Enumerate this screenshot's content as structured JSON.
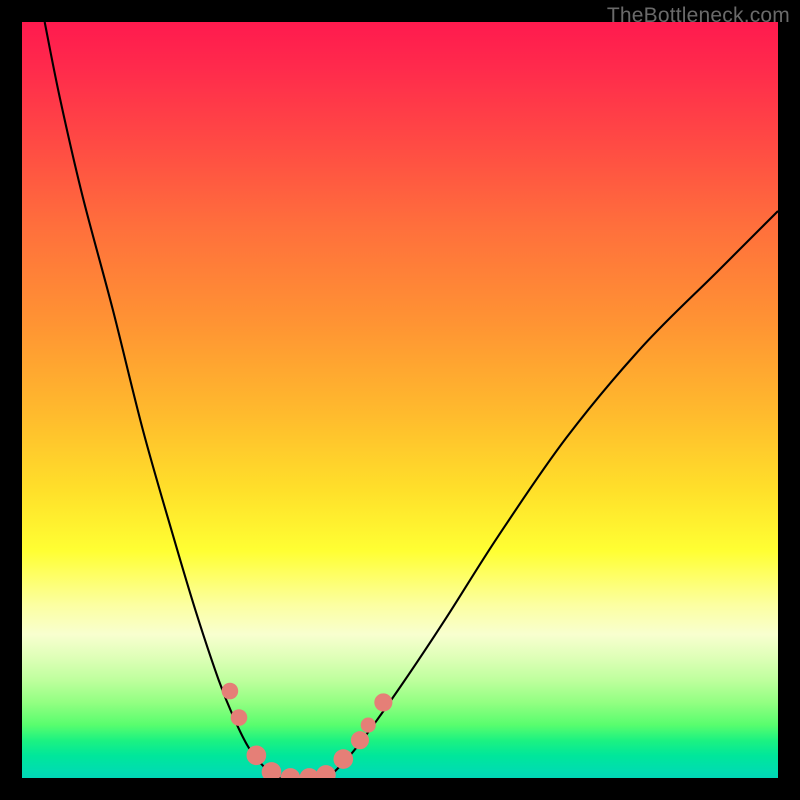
{
  "watermark": "TheBottleneck.com",
  "colors": {
    "marker": "#e57f77",
    "curve": "#000000"
  },
  "chart_data": {
    "type": "line",
    "title": "",
    "xlabel": "",
    "ylabel": "",
    "xlim": [
      0,
      100
    ],
    "ylim": [
      0,
      100
    ],
    "series": [
      {
        "name": "left-curve",
        "x": [
          3,
          5,
          8,
          12,
          16,
          20,
          23,
          26,
          28,
          30,
          32,
          34
        ],
        "y": [
          100,
          90,
          77,
          62,
          46,
          32,
          22,
          13,
          8,
          4,
          1.5,
          0
        ]
      },
      {
        "name": "valley-floor",
        "x": [
          34,
          37,
          40
        ],
        "y": [
          0,
          0,
          0
        ]
      },
      {
        "name": "right-curve",
        "x": [
          40,
          42,
          45,
          50,
          56,
          63,
          72,
          82,
          92,
          100
        ],
        "y": [
          0,
          1.5,
          5,
          12,
          21,
          32,
          45,
          57,
          67,
          75
        ]
      }
    ],
    "markers": {
      "name": "highlighted-points",
      "points": [
        {
          "x": 27.5,
          "y": 11.5,
          "r": 1.1
        },
        {
          "x": 28.7,
          "y": 8.0,
          "r": 1.1
        },
        {
          "x": 31.0,
          "y": 3.0,
          "r": 1.3
        },
        {
          "x": 33.0,
          "y": 0.8,
          "r": 1.3
        },
        {
          "x": 35.5,
          "y": 0.0,
          "r": 1.3
        },
        {
          "x": 38.0,
          "y": 0.0,
          "r": 1.3
        },
        {
          "x": 40.2,
          "y": 0.4,
          "r": 1.3
        },
        {
          "x": 42.5,
          "y": 2.5,
          "r": 1.3
        },
        {
          "x": 44.7,
          "y": 5.0,
          "r": 1.2
        },
        {
          "x": 45.8,
          "y": 7.0,
          "r": 1.0
        },
        {
          "x": 47.8,
          "y": 10.0,
          "r": 1.2
        }
      ]
    }
  }
}
